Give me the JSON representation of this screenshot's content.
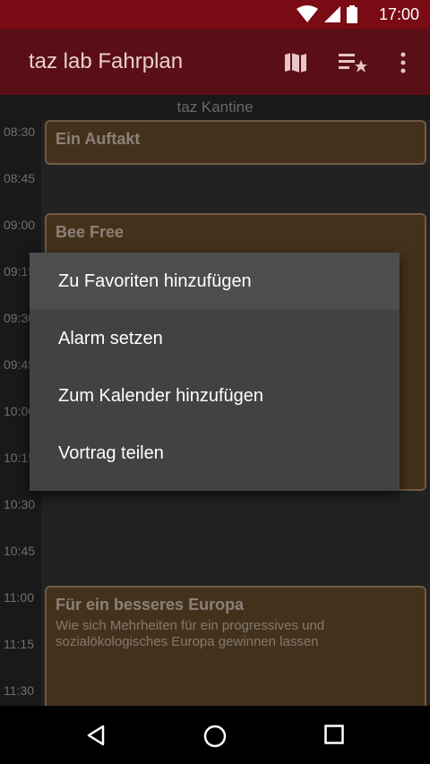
{
  "status_bar": {
    "time": "17:00",
    "icons": [
      "wifi-icon",
      "signal-icon",
      "battery-icon"
    ]
  },
  "app_bar": {
    "title": "taz lab Fahrplan",
    "actions": [
      "map-icon",
      "starred-list-icon",
      "overflow-menu-icon"
    ]
  },
  "room": {
    "name": "taz Kantine"
  },
  "times": [
    "08:30",
    "08:45",
    "09:00",
    "09:15",
    "09:30",
    "09:45",
    "10:00",
    "10:15",
    "10:30",
    "10:45",
    "11:00",
    "11:15",
    "11:30"
  ],
  "events": [
    {
      "title": "Ein Auftakt",
      "subtitle": ""
    },
    {
      "title": "Bee Free",
      "subtitle": ""
    },
    {
      "title": "Für ein besseres Europa",
      "subtitle": "Wie sich Mehrheiten für ein progressives und sozialökologisches Europa gewinnen lassen"
    }
  ],
  "context_menu": {
    "items": [
      "Zu Favoriten hinzufügen",
      "Alarm setzen",
      "Zum Kalender hinzufügen",
      "Vortrag teilen"
    ]
  },
  "nav_bar": {
    "buttons": [
      "back-icon",
      "home-icon",
      "recents-icon"
    ]
  },
  "colors": {
    "status_bar": "#7a0a14",
    "app_bar": "#5a0f16",
    "event_card": "#7c5a34",
    "event_border": "#caa67a",
    "menu_bg": "#424242"
  }
}
